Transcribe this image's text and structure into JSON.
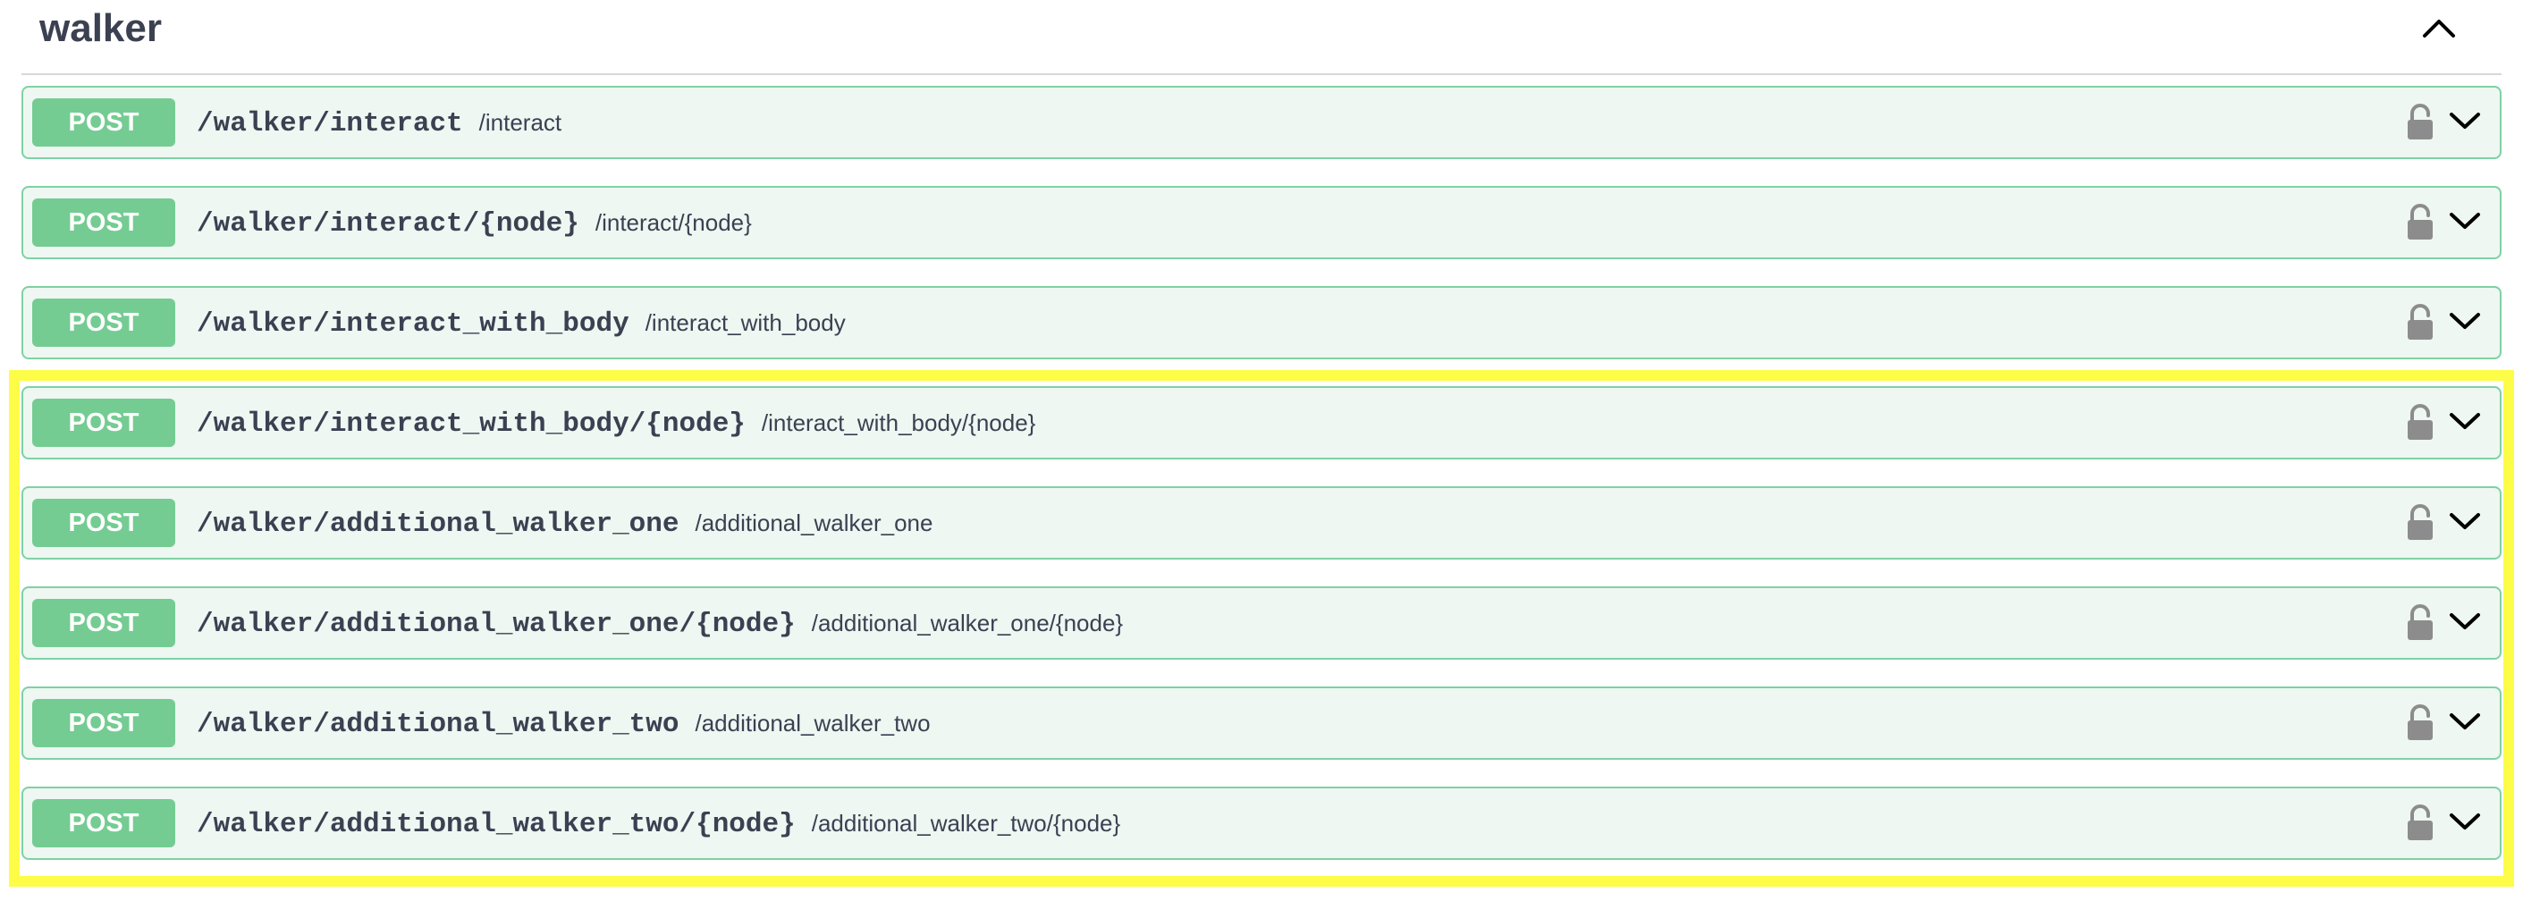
{
  "section": {
    "title": "walker",
    "collapse_icon": "chevron-up-icon"
  },
  "operations": [
    {
      "method": "POST",
      "path": "/walker/interact",
      "summary": "/interact"
    },
    {
      "method": "POST",
      "path": "/walker/interact/{node}",
      "summary": "/interact/{node}"
    },
    {
      "method": "POST",
      "path": "/walker/interact_with_body",
      "summary": "/interact_with_body"
    },
    {
      "method": "POST",
      "path": "/walker/interact_with_body/{node}",
      "summary": "/interact_with_body/{node}"
    },
    {
      "method": "POST",
      "path": "/walker/additional_walker_one",
      "summary": "/additional_walker_one"
    },
    {
      "method": "POST",
      "path": "/walker/additional_walker_one/{node}",
      "summary": "/additional_walker_one/{node}"
    },
    {
      "method": "POST",
      "path": "/walker/additional_walker_two",
      "summary": "/additional_walker_two"
    },
    {
      "method": "POST",
      "path": "/walker/additional_walker_two/{node}",
      "summary": "/additional_walker_two/{node}"
    }
  ],
  "icons": {
    "lock": "lock-icon",
    "expand": "chevron-down-icon"
  },
  "colors": {
    "post_badge": "#74cc92",
    "post_row_bg": "#eef7f2",
    "post_row_border": "#7fd1a4",
    "highlight": "#fdfc47",
    "text": "#3b4151"
  }
}
